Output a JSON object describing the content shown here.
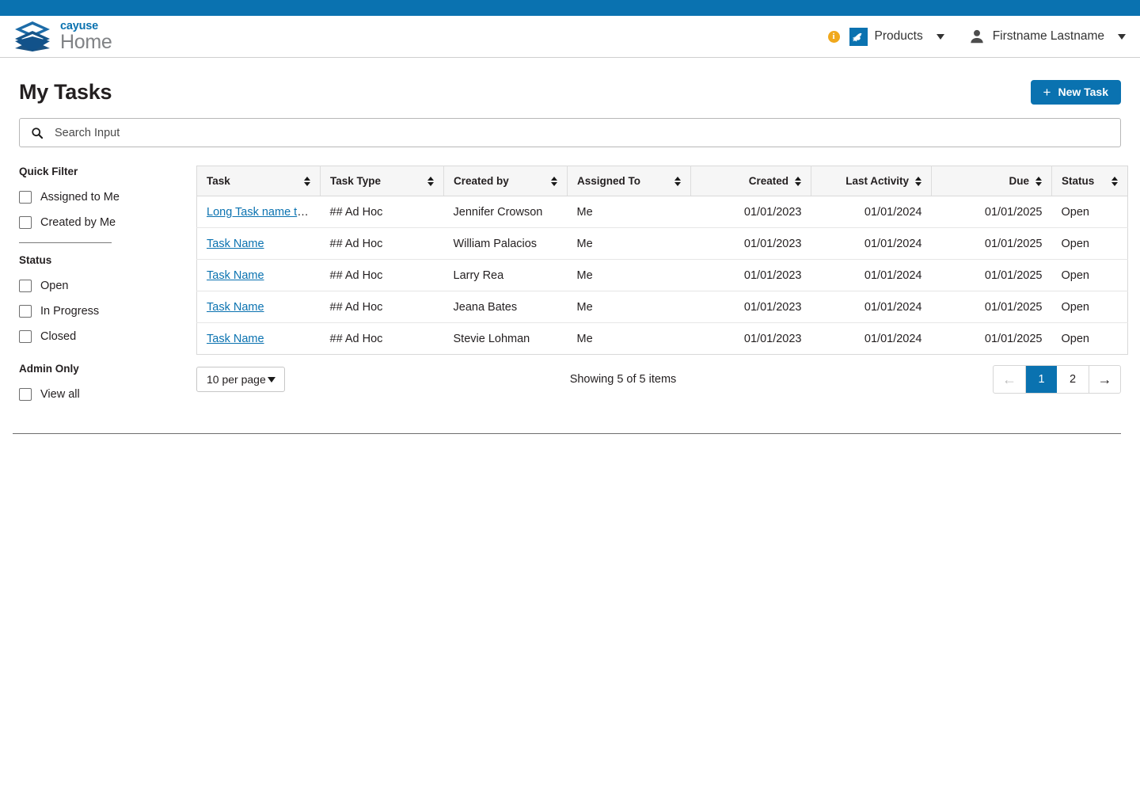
{
  "brand": {
    "name": "cayuse",
    "product": "Home",
    "logo_icon": "cayuse-layers-logo"
  },
  "masthead": {
    "info_badge": "i",
    "products_label": "Products",
    "products_icon": "pegasus-square-icon",
    "products_caret": "chevron-down-icon",
    "user_name": "Firstname Lastname",
    "user_icon": "person-avatar-icon",
    "user_caret": "chevron-down-icon"
  },
  "page": {
    "title": "My Tasks",
    "new_task_label": "New Task",
    "new_task_plus": "+"
  },
  "search": {
    "placeholder": "Search Input",
    "value": "",
    "icon": "search-icon"
  },
  "sidebar": {
    "groups": [
      {
        "title": "Quick Filter",
        "options": [
          {
            "label": "Assigned to Me",
            "checked": false
          },
          {
            "label": "Created by Me",
            "checked": false
          }
        ]
      },
      {
        "title": "Status",
        "options": [
          {
            "label": "Open",
            "checked": false
          },
          {
            "label": "In Progress",
            "checked": false
          },
          {
            "label": "Closed",
            "checked": false
          }
        ]
      },
      {
        "title": "Admin Only",
        "options": [
          {
            "label": "View all",
            "checked": false
          }
        ]
      }
    ]
  },
  "table": {
    "columns": [
      {
        "label": "Task",
        "align": "left",
        "sortable": true
      },
      {
        "label": "Task Type",
        "align": "left",
        "sortable": true
      },
      {
        "label": "Created by",
        "align": "left",
        "sortable": true
      },
      {
        "label": "Assigned To",
        "align": "left",
        "sortable": true
      },
      {
        "label": "Created",
        "align": "right",
        "sortable": true
      },
      {
        "label": "Last Activity",
        "align": "right",
        "sortable": true
      },
      {
        "label": "Due",
        "align": "right",
        "sortable": true
      },
      {
        "label": "Status",
        "align": "left",
        "sortable": true
      }
    ],
    "rows": [
      {
        "task": "Long Task name th…",
        "task_type": "## Ad Hoc",
        "created_by": "Jennifer Crowson",
        "assigned_to": "Me",
        "created": "01/01/2023",
        "last_activity": "01/01/2024",
        "due": "01/01/2025",
        "status": "Open"
      },
      {
        "task": "Task Name",
        "task_type": "## Ad Hoc",
        "created_by": "William Palacios",
        "assigned_to": "Me",
        "created": "01/01/2023",
        "last_activity": "01/01/2024",
        "due": "01/01/2025",
        "status": "Open"
      },
      {
        "task": "Task Name",
        "task_type": "## Ad Hoc",
        "created_by": "Larry Rea",
        "assigned_to": "Me",
        "created": "01/01/2023",
        "last_activity": "01/01/2024",
        "due": "01/01/2025",
        "status": "Open"
      },
      {
        "task": "Task Name",
        "task_type": "## Ad Hoc",
        "created_by": "Jeana Bates",
        "assigned_to": "Me",
        "created": "01/01/2023",
        "last_activity": "01/01/2024",
        "due": "01/01/2025",
        "status": "Open"
      },
      {
        "task": "Task Name",
        "task_type": "## Ad Hoc",
        "created_by": "Stevie Lohman",
        "assigned_to": "Me",
        "created": "01/01/2023",
        "last_activity": "01/01/2024",
        "due": "01/01/2025",
        "status": "Open"
      }
    ]
  },
  "footer": {
    "per_page_label": "10 per page",
    "showing_text": "Showing 5 of 5 items",
    "prev_arrow": "←",
    "next_arrow": "→",
    "pages": [
      "1",
      "2"
    ],
    "active_page": "1"
  },
  "colors": {
    "brand_blue": "#0a72b0",
    "link_blue": "#0a72b0",
    "badge_orange": "#f0a81c",
    "header_grey": "#f6f6f6"
  }
}
